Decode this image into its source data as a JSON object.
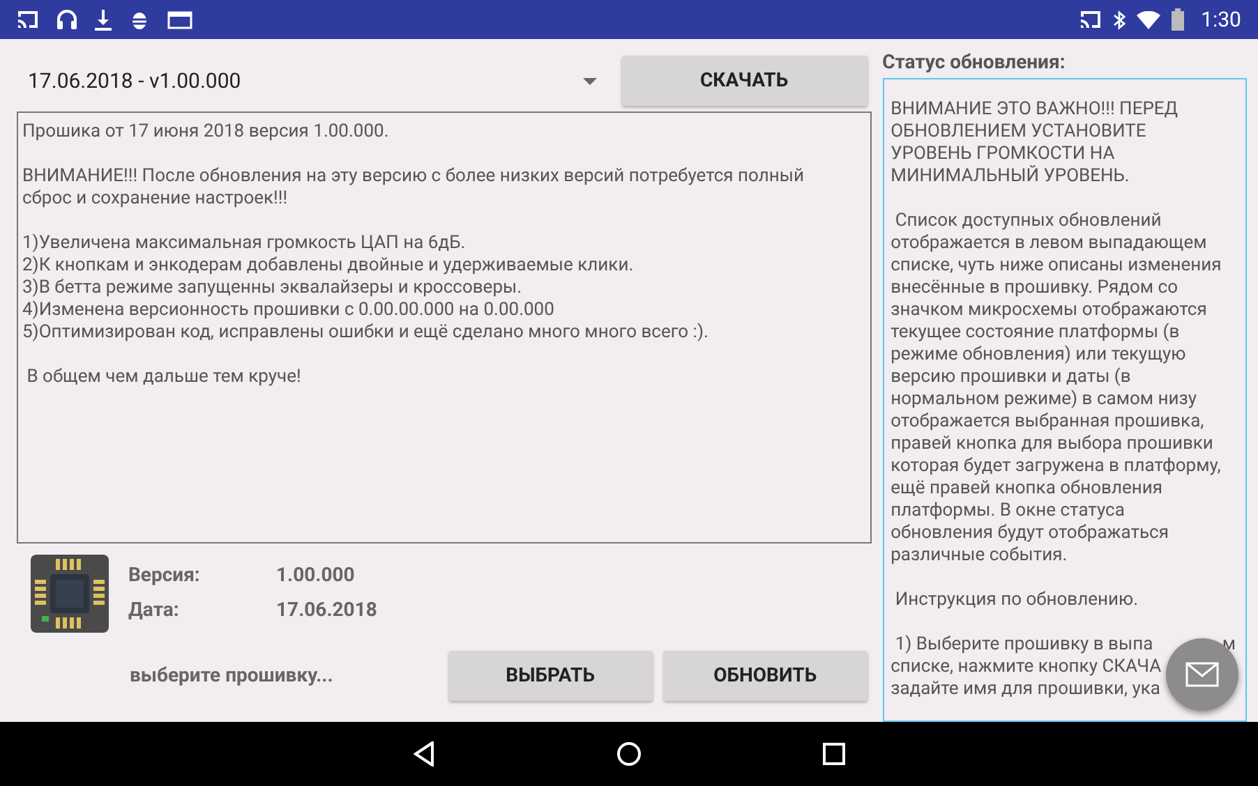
{
  "status_bar": {
    "time": "1:30"
  },
  "firmware_select": {
    "value": "17.06.2018 - v1.00.000"
  },
  "download_button": "СКАЧАТЬ",
  "changelog": [
    {
      "lines": [
        "Прошика от 17 июня 2018 версия 1.00.000."
      ]
    },
    {
      "lines": [
        "ВНИМАНИЕ!!! После обновления на эту версию с более низких версий потребуется полный",
        "сброс и сохранение настроек!!!"
      ]
    },
    {
      "lines": [
        "1)Увеличена максимальная громкость ЦАП на 6дБ.",
        "2)К кнопкам и энкодерам добавлены двойные и удерживаемые клики.",
        "3)В бетта режиме запущенны эквалайзеры и кроссоверы.",
        "4)Изменена версионность прошивки с 0.00.00.000 на 0.00.000",
        "5)Оптимизирован код, исправлены ошибки и ещё сделано много много всего :)."
      ]
    },
    {
      "lines": [
        " В общем чем дальше тем круче!"
      ]
    }
  ],
  "device_info": [
    {
      "label": "Версия:",
      "value": "1.00.000"
    },
    {
      "label": "Дата:",
      "value": "17.06.2018"
    }
  ],
  "selected_firmware": "выберите прошивку...",
  "buttons": [
    "ВЫБРАТЬ",
    "ОБНОВИТЬ"
  ],
  "status_panel": {
    "title": "Статус обновления:",
    "paragraphs": [
      {
        "lines": [
          "ВНИМАНИЕ ЭТО ВАЖНО!!! ПЕРЕД",
          "ОБНОВЛЕНИЕМ УСТАНОВИТЕ",
          "УРОВЕНЬ ГРОМКОСТИ НА",
          "МИНИМАЛЬНЫЙ УРОВЕНЬ."
        ]
      },
      {
        "lines": [
          " Список доступных обновлений",
          "отображается в левом выпадающем",
          "списке, чуть ниже описаны изменения",
          "внесённые в прошивку. Рядом со",
          "значком микросхемы отображаются",
          "текущее состояние платформы (в",
          "режиме обновления) или текущую",
          "версию прошивки и даты (в",
          "нормальном режиме) в самом низу",
          "отображается выбранная прошивка,",
          "правей кнопка для выбора прошивки",
          "которая будет загружена в платформу,",
          "ещё правей кнопка обновления",
          "платформы. В окне статуса",
          "обновления будут отображаться",
          "различные события."
        ]
      },
      {
        "lines": [
          " Инструкция по обновлению."
        ]
      },
      {
        "lines": [
          " 1) Выберите прошивку в выпа",
          "списке, нажмите кнопку СКАЧА",
          "задайте имя для прошивки, ука"
        ],
        "first_line_tail": "м"
      }
    ]
  }
}
